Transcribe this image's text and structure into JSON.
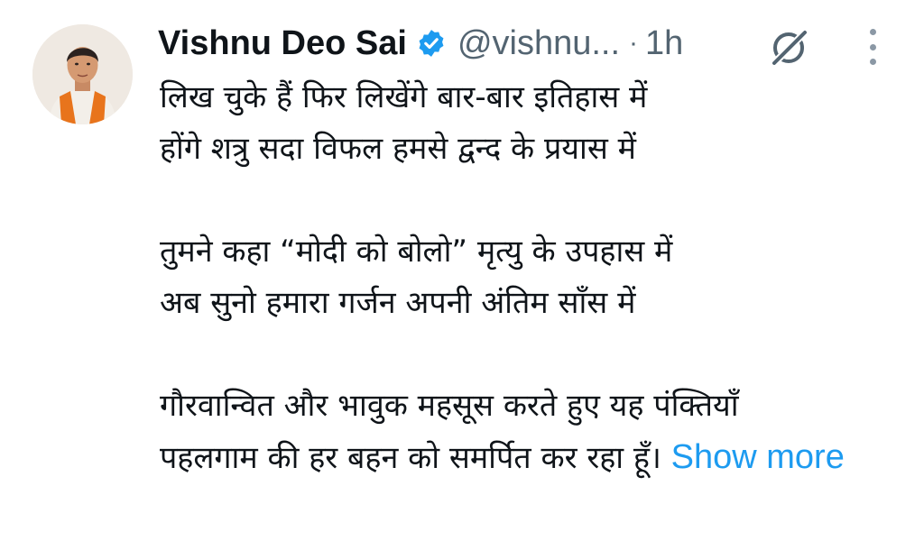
{
  "tweet": {
    "author_name": "Vishnu Deo Sai",
    "handle": "@vishnu...",
    "separator": "·",
    "time": "1h",
    "verified_icon": "verified-badge-icon",
    "verified_color": "#1d9bf0",
    "avatar_icon": "avatar",
    "grok_icon": "grok-icon",
    "more_icon": "more-options-icon",
    "lines": [
      "लिख चुके हैं फिर लिखेंगे बार-बार इतिहास में",
      "होंगे शत्रु सदा विफल हमसे द्वन्द के प्रयास में",
      "तुमने कहा “मोदी को बोलो” मृत्यु के उपहास में",
      "अब सुनो हमारा गर्जन अपनी अंतिम साँस में",
      "गौरवान्वित और भावुक महसूस करते हुए यह पंक्तियाँ",
      "पहलगाम की हर बहन को समर्पित कर रहा हूँ।"
    ],
    "show_more_label": "Show more",
    "link_color": "#1d9bf0"
  }
}
